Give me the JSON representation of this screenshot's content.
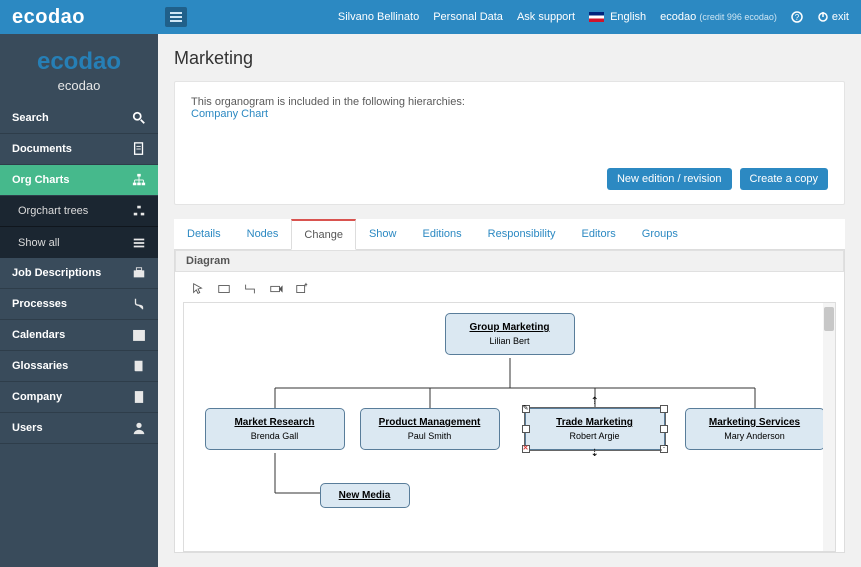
{
  "topbar": {
    "brand": "ecodao",
    "user": "Silvano Bellinato",
    "personal": "Personal Data",
    "ask": "Ask support",
    "lang": "English",
    "tenant": "ecodao",
    "credit": "(credit 996 ecodao)",
    "exit": "exit"
  },
  "sidebar": {
    "brand": "ecodao",
    "company": "ecodao",
    "items": [
      {
        "label": "Search",
        "icon": "search"
      },
      {
        "label": "Documents",
        "icon": "file"
      },
      {
        "label": "Org Charts",
        "icon": "org",
        "active": true
      },
      {
        "label": "Job Descriptions",
        "icon": "briefcase"
      },
      {
        "label": "Processes",
        "icon": "process"
      },
      {
        "label": "Calendars",
        "icon": "calendar"
      },
      {
        "label": "Glossaries",
        "icon": "book"
      },
      {
        "label": "Company",
        "icon": "building"
      },
      {
        "label": "Users",
        "icon": "user"
      }
    ],
    "sub": [
      {
        "label": "Orgchart trees",
        "icon": "tree"
      },
      {
        "label": "Show all",
        "icon": "list"
      }
    ]
  },
  "page": {
    "title": "Marketing",
    "panel_text": "This organogram is included in the following hierarchies:",
    "panel_link": "Company Chart",
    "btn_new": "New edition / revision",
    "btn_copy": "Create a copy"
  },
  "tabs": [
    "Details",
    "Nodes",
    "Change",
    "Show",
    "Editions",
    "Responsibility",
    "Editors",
    "Groups"
  ],
  "active_tab": "Change",
  "diagram_label": "Diagram",
  "chart_data": {
    "type": "tree",
    "nodes": [
      {
        "id": "root",
        "title": "Group Marketing",
        "person": "Lilian Bert",
        "children": [
          "mr",
          "pm",
          "tm",
          "ms"
        ]
      },
      {
        "id": "mr",
        "title": "Market Research",
        "person": "Brenda Gall",
        "children": [
          "nm"
        ]
      },
      {
        "id": "pm",
        "title": "Product Management",
        "person": "Paul Smith"
      },
      {
        "id": "tm",
        "title": "Trade Marketing",
        "person": "Robert Argie",
        "selected": true
      },
      {
        "id": "ms",
        "title": "Marketing Services",
        "person": "Mary Anderson"
      },
      {
        "id": "nm",
        "title": "New Media",
        "person": ""
      }
    ]
  }
}
